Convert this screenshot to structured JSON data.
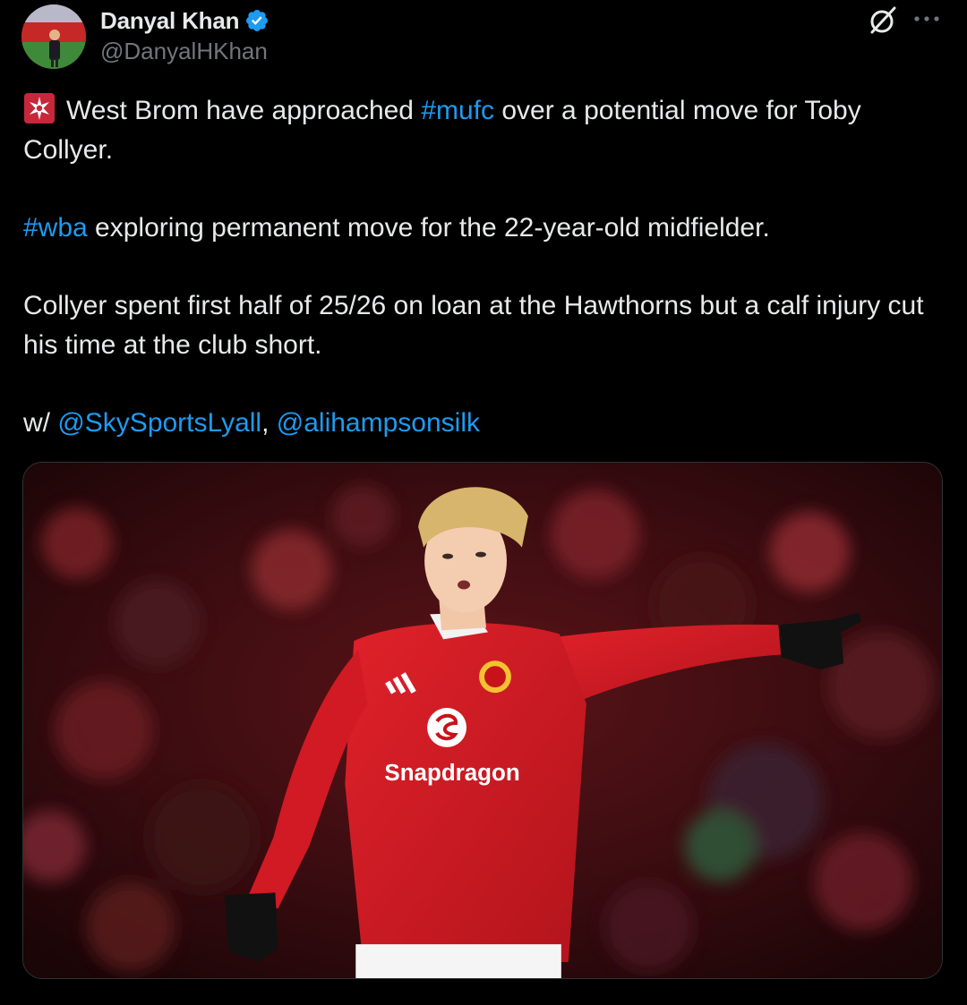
{
  "author": {
    "display_name": "Danyal Khan",
    "handle": "@DanyalHKhan",
    "verified": true,
    "avatar_icon": "profile-photo"
  },
  "icons": {
    "verified": "verified-badge-icon",
    "grok": "grok-icon",
    "more": "more-options-icon",
    "siren": "police-light-emoji"
  },
  "tweet": {
    "line1_prefix": "West Brom have approached ",
    "line1_hashtag": "#mufc",
    "line1_suffix": " over a potential move for Toby Collyer.",
    "line2_hashtag": "#wba",
    "line2_suffix": " exploring permanent move for the 22-year-old midfielder.",
    "line3": "Collyer spent first half of 25/26 on loan at the Hawthorns but a calf injury cut his time at the club short.",
    "line4_prefix": "w/ ",
    "mention1": "@SkySportsLyall",
    "mention_sep": ", ",
    "mention2": "@alihampsonsilk"
  },
  "media": {
    "kind": "photo",
    "shirt_sponsor": "Snapdragon"
  },
  "colors": {
    "background": "#000000",
    "text": "#e7e9ea",
    "secondary_text": "#71767b",
    "link": "#1d9bf0",
    "verified": "#1d9bf0"
  }
}
